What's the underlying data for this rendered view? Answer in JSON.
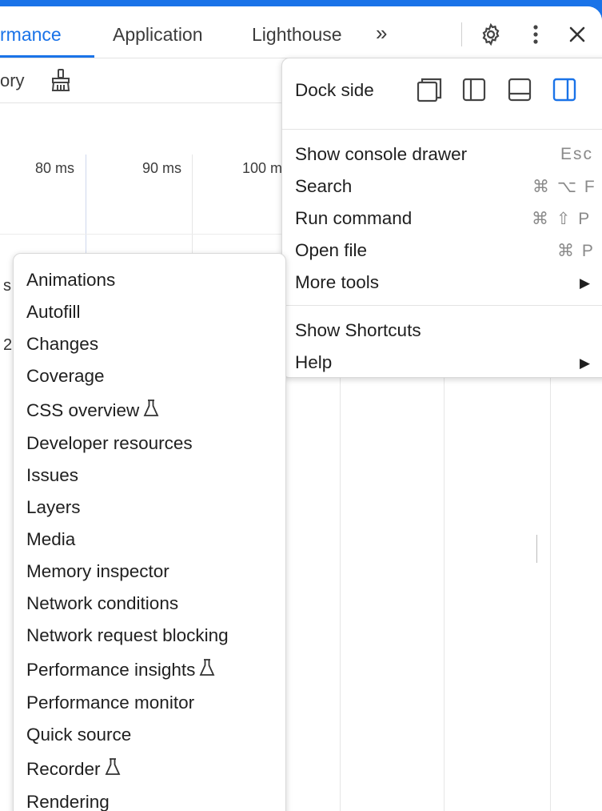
{
  "tabs": [
    {
      "label": "rmance",
      "active": true
    },
    {
      "label": "Application",
      "active": false
    },
    {
      "label": "Lighthouse",
      "active": false
    }
  ],
  "tabs_overflow": "»",
  "toolbar": {
    "partial_label": "ory"
  },
  "ruler": {
    "labels": [
      "80 ms",
      "90 ms",
      "100 m"
    ]
  },
  "edge_chars": [
    "s",
    "2"
  ],
  "main_menu": {
    "dock_side_label": "Dock side",
    "dock_options": [
      "undock",
      "dock-left",
      "dock-bottom",
      "dock-right"
    ],
    "dock_selected": "dock-right",
    "items": [
      {
        "label": "Show console drawer",
        "shortcut": "Esc"
      },
      {
        "label": "Search",
        "shortcut": "⌘ ⌥ F"
      },
      {
        "label": "Run command",
        "shortcut": "⌘ ⇧ P"
      },
      {
        "label": "Open file",
        "shortcut": "⌘ P"
      },
      {
        "label": "More tools",
        "shortcut": "▶"
      }
    ],
    "items2": [
      {
        "label": "Show Shortcuts",
        "shortcut": ""
      },
      {
        "label": "Help",
        "shortcut": "▶"
      }
    ]
  },
  "more_tools": {
    "items": [
      {
        "label": "Animations",
        "experimental": false
      },
      {
        "label": "Autofill",
        "experimental": false
      },
      {
        "label": "Changes",
        "experimental": false
      },
      {
        "label": "Coverage",
        "experimental": false
      },
      {
        "label": "CSS overview",
        "experimental": true
      },
      {
        "label": "Developer resources",
        "experimental": false
      },
      {
        "label": "Issues",
        "experimental": false
      },
      {
        "label": "Layers",
        "experimental": false
      },
      {
        "label": "Media",
        "experimental": false
      },
      {
        "label": "Memory inspector",
        "experimental": false
      },
      {
        "label": "Network conditions",
        "experimental": false
      },
      {
        "label": "Network request blocking",
        "experimental": false
      },
      {
        "label": "Performance insights",
        "experimental": true
      },
      {
        "label": "Performance monitor",
        "experimental": false
      },
      {
        "label": "Quick source",
        "experimental": false
      },
      {
        "label": "Recorder",
        "experimental": true
      },
      {
        "label": "Rendering",
        "experimental": false
      }
    ]
  },
  "colors": {
    "accent": "#1a73e8",
    "frame": "#1a73e8"
  },
  "icons": {
    "settings": "gear-icon",
    "more": "kebab-icon",
    "close": "close-icon",
    "clear": "broom-icon",
    "experimental": "flask-icon"
  }
}
